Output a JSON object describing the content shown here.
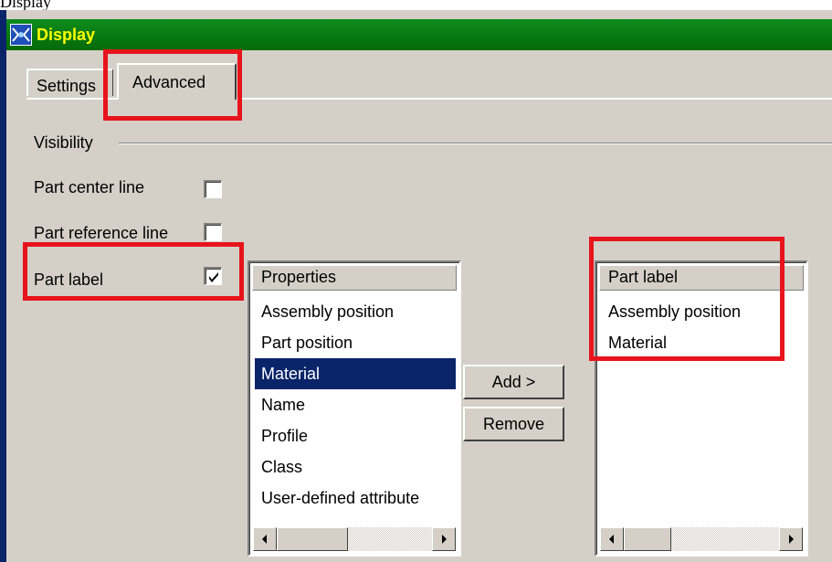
{
  "page_caption": "Display",
  "window": {
    "title": "Display",
    "title_color": "#ffff00",
    "titlebar_color": "#07770f"
  },
  "tabs": [
    {
      "label": "Settings",
      "selected": false
    },
    {
      "label": "Advanced",
      "selected": true
    }
  ],
  "visibility": {
    "group_label": "Visibility",
    "part_center_line": {
      "label": "Part center line",
      "checked": false
    },
    "part_reference_line": {
      "label": "Part reference line",
      "checked": false
    },
    "part_label": {
      "label": "Part label",
      "checked": true
    }
  },
  "properties_list": {
    "header": "Properties",
    "items": [
      "Assembly position",
      "Part position",
      "Material",
      "Name",
      "Profile",
      "Class",
      "User-defined attribute"
    ],
    "selected_index": 2
  },
  "buttons": {
    "add": "Add >",
    "remove": "Remove"
  },
  "part_label_list": {
    "header": "Part label",
    "items": [
      "Assembly position",
      "Material"
    ]
  },
  "highlight_color": "#e8141c"
}
